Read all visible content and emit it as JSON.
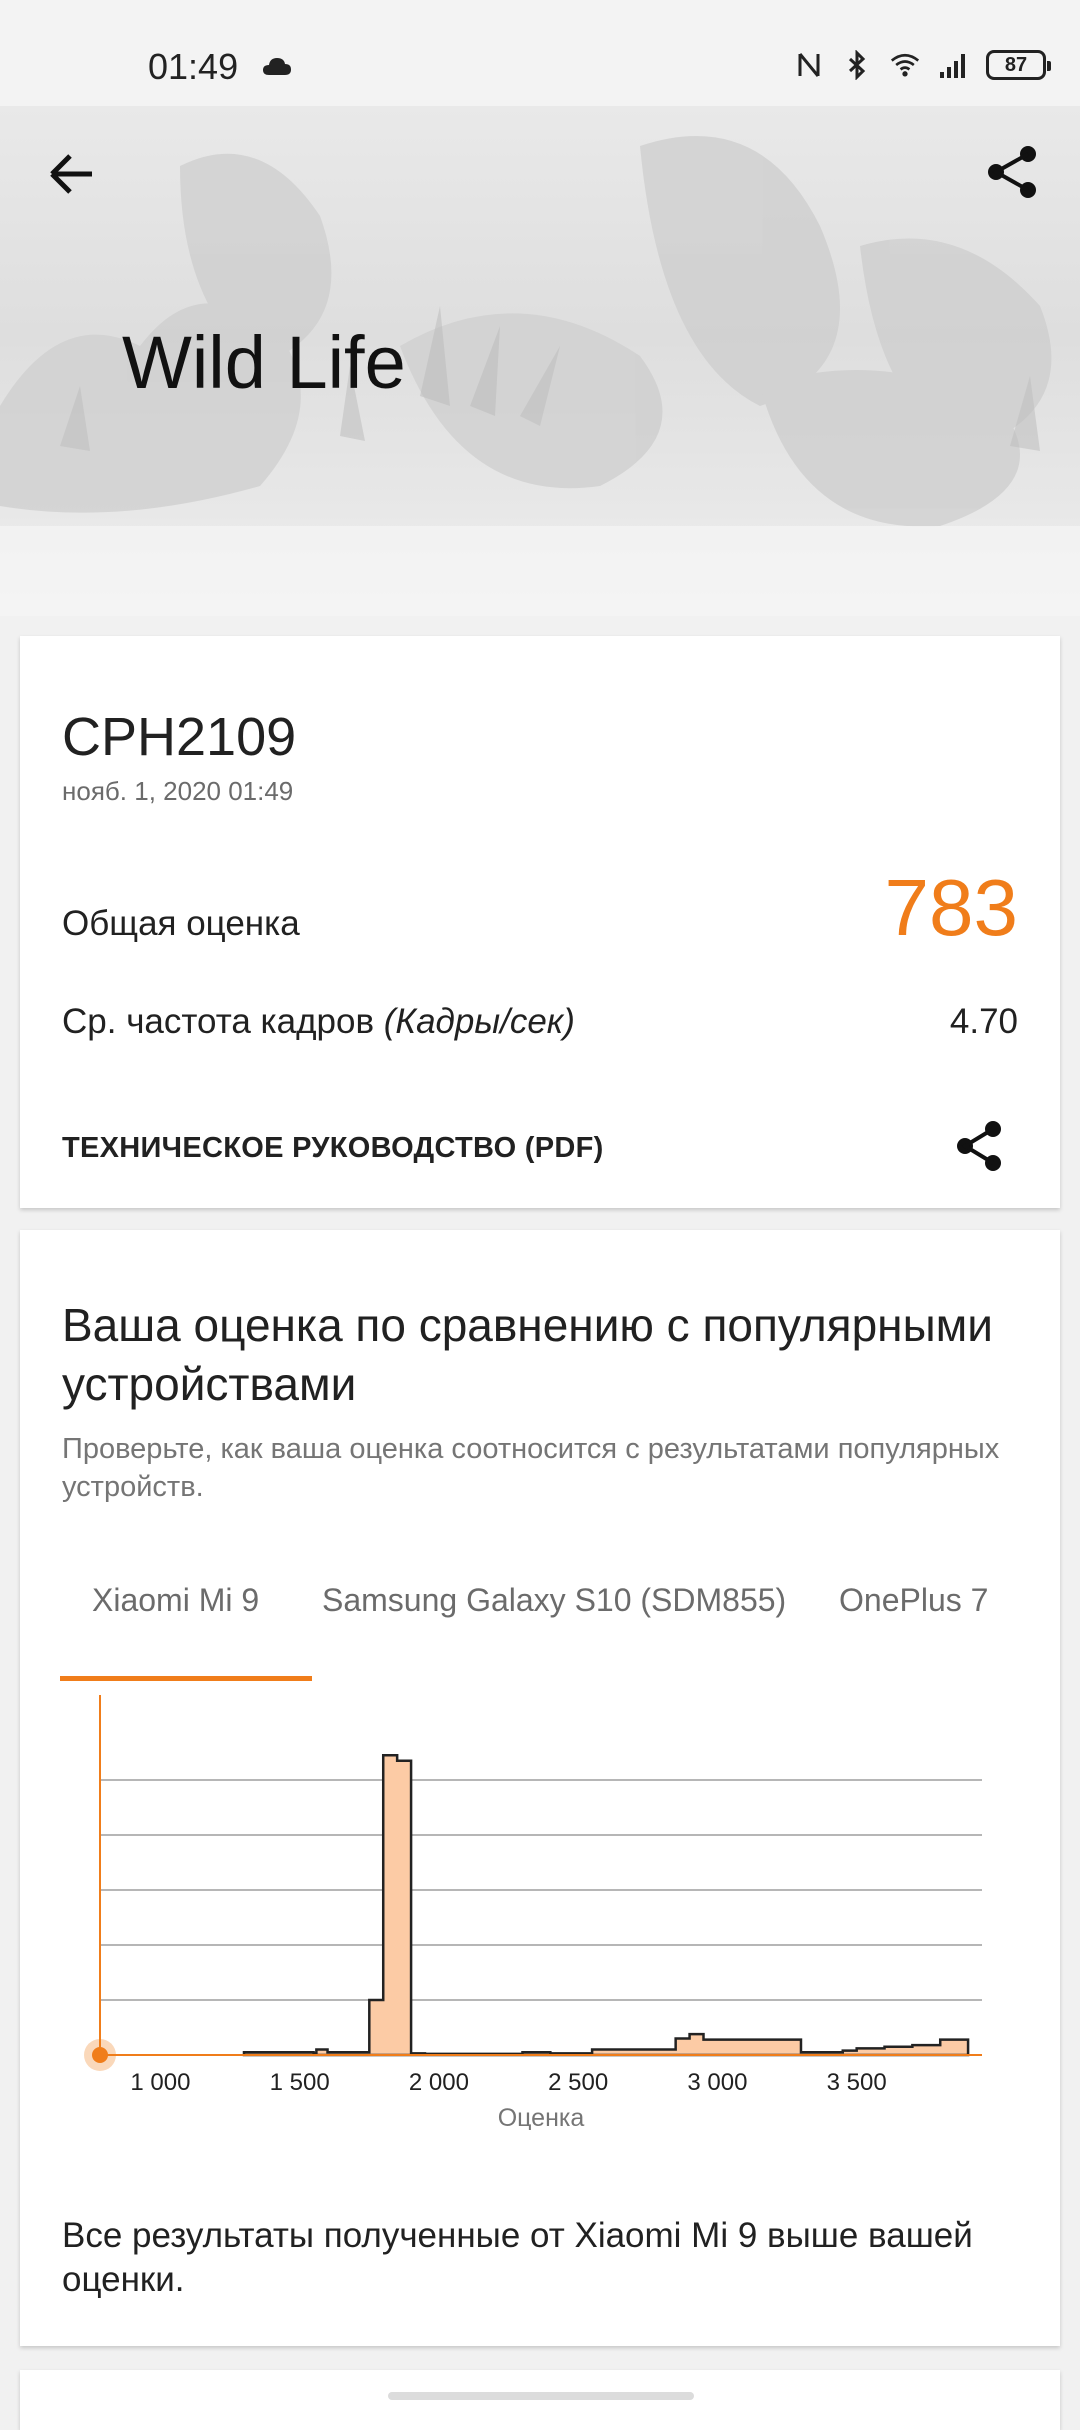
{
  "status_bar": {
    "time": "01:49",
    "battery": "87",
    "icons": [
      "cloud-icon",
      "nfc-icon",
      "bluetooth-icon",
      "wifi-icon",
      "signal-icon",
      "battery-icon"
    ]
  },
  "hero": {
    "title": "Wild Life",
    "back_icon": "arrow-left-icon",
    "share_icon": "share-icon"
  },
  "result_card": {
    "device": "CPH2109",
    "date": "нояб. 1, 2020 01:49",
    "overall_label": "Общая оценка",
    "overall_score": "783",
    "fps_label": "Ср. частота кадров",
    "fps_unit": "(Кадры/сек)",
    "fps_value": "4.70",
    "tech_guide": "ТЕХНИЧЕСКОЕ РУКОВОДСТВО (PDF)"
  },
  "comparison": {
    "title": "Ваша оценка по сравнению с популярными устройствами",
    "subtitle": "Проверьте, как ваша оценка соотносится с результатами популярных устройств.",
    "tabs": [
      {
        "label": "Xiaomi Mi 9",
        "selected": true
      },
      {
        "label": "Samsung Galaxy S10 (SDM855)",
        "selected": false
      },
      {
        "label": "OnePlus 7",
        "selected": false
      }
    ],
    "summary": "Все результаты полученные от Xiaomi Mi 9 выше вашей оценки."
  },
  "colors": {
    "accent": "#f07d1a",
    "bar_fill": "#fccba5",
    "bar_stroke": "#222222",
    "grid": "#9e9e9e"
  },
  "chart_data": {
    "type": "area",
    "xlabel": "Оценка",
    "ylabel": "",
    "xlim": [
      783,
      3950
    ],
    "ylim": [
      0,
      6
    ],
    "x_ticks": [
      1000,
      1500,
      2000,
      2500,
      3000,
      3500
    ],
    "x_tick_labels": [
      "1 000",
      "1 500",
      "2 000",
      "2 500",
      "3 000",
      "3 500"
    ],
    "grid": true,
    "your_score_marker": 783,
    "series": [
      {
        "x": [
          1300,
          1550,
          1560,
          1600,
          1630,
          1650,
          1750,
          1800,
          1850,
          1900,
          1950,
          2000,
          2050,
          2100,
          2200,
          2300,
          2400,
          2500,
          2550,
          2600,
          2700,
          2750,
          2800,
          2850,
          2900,
          2950,
          3000,
          3050,
          3100,
          3200,
          3300,
          3400,
          3450,
          3500,
          3600,
          3700,
          3800,
          3850,
          3900
        ],
        "values": [
          0.05,
          0.03,
          0.1,
          0.05,
          0.05,
          0.05,
          1.0,
          5.45,
          5.35,
          0.03,
          0.02,
          0.02,
          0.02,
          0.02,
          0.02,
          0.05,
          0.03,
          0.03,
          0.1,
          0.1,
          0.1,
          0.1,
          0.1,
          0.3,
          0.38,
          0.28,
          0.28,
          0.28,
          0.28,
          0.28,
          0.05,
          0.05,
          0.08,
          0.12,
          0.15,
          0.18,
          0.28,
          0.28,
          0
        ]
      }
    ]
  }
}
